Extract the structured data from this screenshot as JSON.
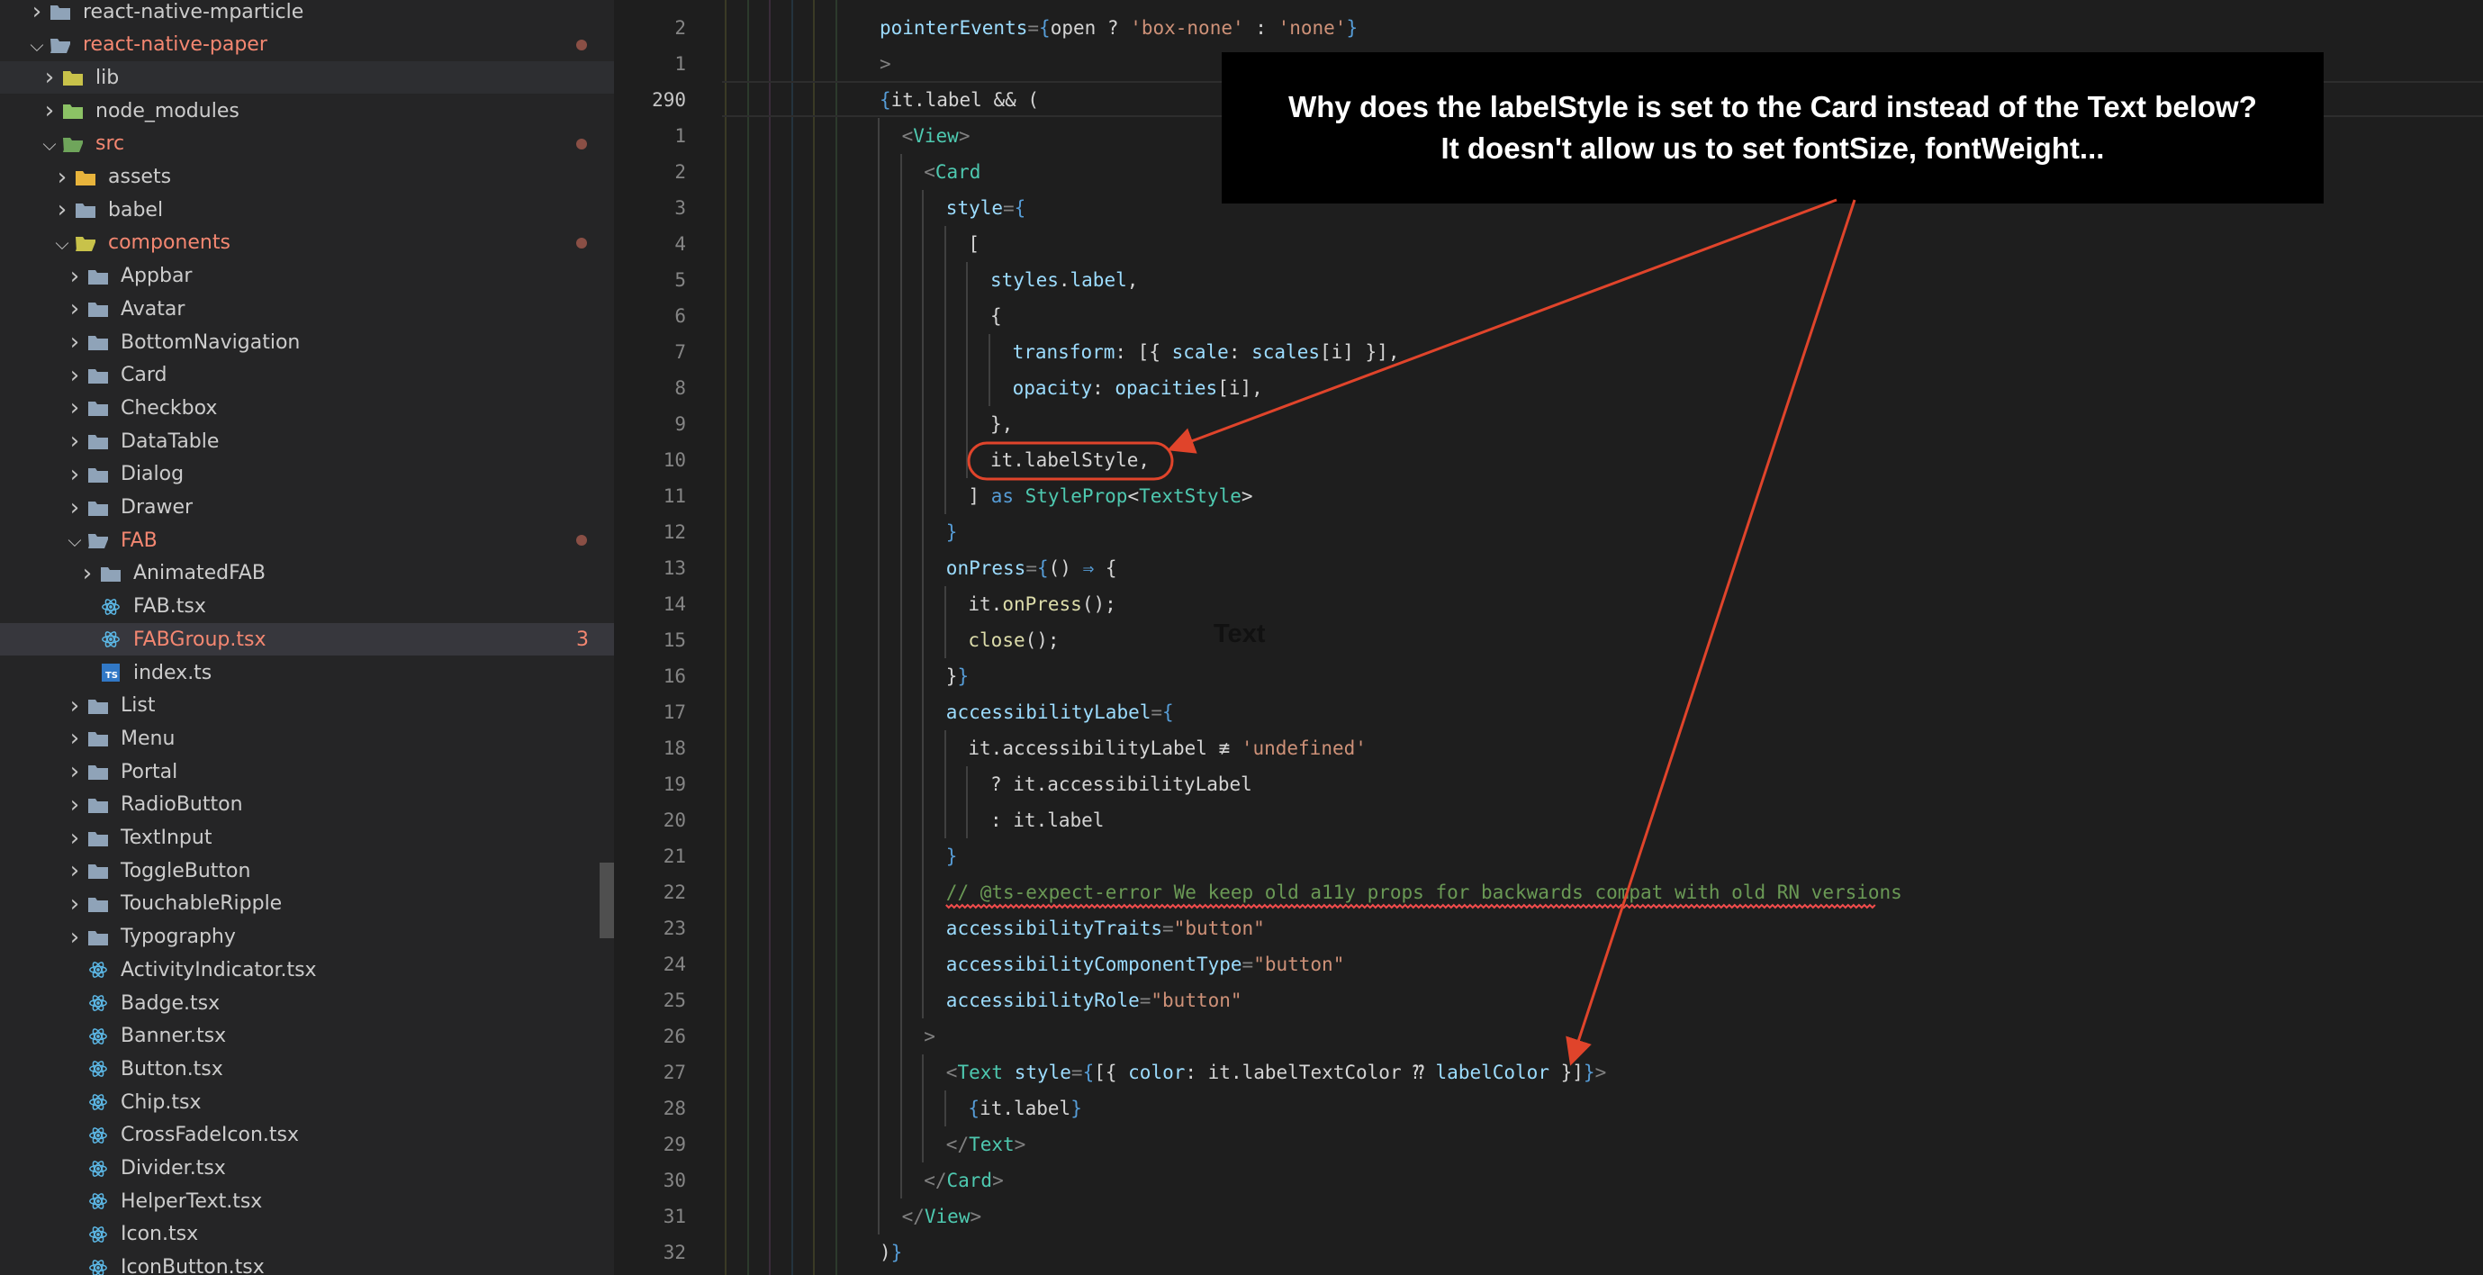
{
  "explorer": {
    "items": [
      {
        "label": "react-native-mparticle",
        "depth": 1,
        "kind": "folder",
        "open": false,
        "modified": false
      },
      {
        "label": "react-native-paper",
        "depth": 1,
        "kind": "folder",
        "open": true,
        "modified": true
      },
      {
        "label": "lib",
        "depth": 2,
        "kind": "folder-lib",
        "open": false,
        "modified": false
      },
      {
        "label": "node_modules",
        "depth": 2,
        "kind": "folder-node",
        "open": false,
        "modified": false
      },
      {
        "label": "src",
        "depth": 2,
        "kind": "folder-src",
        "open": true,
        "modified": true
      },
      {
        "label": "assets",
        "depth": 3,
        "kind": "folder-assets",
        "open": false,
        "modified": false
      },
      {
        "label": "babel",
        "depth": 3,
        "kind": "folder",
        "open": false,
        "modified": false
      },
      {
        "label": "components",
        "depth": 3,
        "kind": "folder-components",
        "open": true,
        "modified": true
      },
      {
        "label": "Appbar",
        "depth": 4,
        "kind": "folder",
        "open": false,
        "modified": false
      },
      {
        "label": "Avatar",
        "depth": 4,
        "kind": "folder",
        "open": false,
        "modified": false
      },
      {
        "label": "BottomNavigation",
        "depth": 4,
        "kind": "folder",
        "open": false,
        "modified": false
      },
      {
        "label": "Card",
        "depth": 4,
        "kind": "folder",
        "open": false,
        "modified": false
      },
      {
        "label": "Checkbox",
        "depth": 4,
        "kind": "folder",
        "open": false,
        "modified": false
      },
      {
        "label": "DataTable",
        "depth": 4,
        "kind": "folder",
        "open": false,
        "modified": false
      },
      {
        "label": "Dialog",
        "depth": 4,
        "kind": "folder",
        "open": false,
        "modified": false
      },
      {
        "label": "Drawer",
        "depth": 4,
        "kind": "folder",
        "open": false,
        "modified": false
      },
      {
        "label": "FAB",
        "depth": 4,
        "kind": "folder",
        "open": true,
        "modified": true
      },
      {
        "label": "AnimatedFAB",
        "depth": 5,
        "kind": "folder",
        "open": false,
        "modified": false
      },
      {
        "label": "FAB.tsx",
        "depth": 5,
        "kind": "react",
        "modified": false
      },
      {
        "label": "FABGroup.tsx",
        "depth": 5,
        "kind": "react",
        "modified": true,
        "badge": "3",
        "selected": true
      },
      {
        "label": "index.ts",
        "depth": 5,
        "kind": "ts",
        "modified": false
      },
      {
        "label": "List",
        "depth": 4,
        "kind": "folder",
        "open": false,
        "modified": false
      },
      {
        "label": "Menu",
        "depth": 4,
        "kind": "folder",
        "open": false,
        "modified": false
      },
      {
        "label": "Portal",
        "depth": 4,
        "kind": "folder",
        "open": false,
        "modified": false
      },
      {
        "label": "RadioButton",
        "depth": 4,
        "kind": "folder",
        "open": false,
        "modified": false
      },
      {
        "label": "TextInput",
        "depth": 4,
        "kind": "folder",
        "open": false,
        "modified": false
      },
      {
        "label": "ToggleButton",
        "depth": 4,
        "kind": "folder",
        "open": false,
        "modified": false
      },
      {
        "label": "TouchableRipple",
        "depth": 4,
        "kind": "folder",
        "open": false,
        "modified": false
      },
      {
        "label": "Typography",
        "depth": 4,
        "kind": "folder",
        "open": false,
        "modified": false
      },
      {
        "label": "ActivityIndicator.tsx",
        "depth": 4,
        "kind": "react",
        "modified": false
      },
      {
        "label": "Badge.tsx",
        "depth": 4,
        "kind": "react",
        "modified": false
      },
      {
        "label": "Banner.tsx",
        "depth": 4,
        "kind": "react",
        "modified": false
      },
      {
        "label": "Button.tsx",
        "depth": 4,
        "kind": "react",
        "modified": false
      },
      {
        "label": "Chip.tsx",
        "depth": 4,
        "kind": "react",
        "modified": false
      },
      {
        "label": "CrossFadeIcon.tsx",
        "depth": 4,
        "kind": "react",
        "modified": false
      },
      {
        "label": "Divider.tsx",
        "depth": 4,
        "kind": "react",
        "modified": false
      },
      {
        "label": "HelperText.tsx",
        "depth": 4,
        "kind": "react",
        "modified": false
      },
      {
        "label": "Icon.tsx",
        "depth": 4,
        "kind": "react",
        "modified": false
      },
      {
        "label": "IconButton.tsx",
        "depth": 4,
        "kind": "react",
        "modified": false
      }
    ]
  },
  "editor": {
    "lines": [
      {
        "num": "2",
        "indent": 0,
        "tokens": [
          [
            "attr",
            "pointerEvents"
          ],
          [
            "punc",
            "="
          ],
          [
            "br",
            "{"
          ],
          [
            "var",
            "open ? "
          ],
          [
            "str",
            "'box-none'"
          ],
          [
            "var",
            " : "
          ],
          [
            "str",
            "'none'"
          ],
          [
            "br",
            "}"
          ]
        ]
      },
      {
        "num": "1",
        "indent": 0,
        "tokens": [
          [
            "punc",
            ">"
          ]
        ]
      },
      {
        "num": "290",
        "indent": 0,
        "current": true,
        "tokens": [
          [
            "br",
            "{"
          ],
          [
            "var",
            "it.label && ("
          ]
        ]
      },
      {
        "num": "1",
        "indent": 1,
        "tokens": [
          [
            "punc",
            "<"
          ],
          [
            "tag",
            "View"
          ],
          [
            "punc",
            ">"
          ]
        ]
      },
      {
        "num": "2",
        "indent": 2,
        "tokens": [
          [
            "punc",
            "<"
          ],
          [
            "tag",
            "Card"
          ]
        ]
      },
      {
        "num": "3",
        "indent": 3,
        "tokens": [
          [
            "attr",
            "style"
          ],
          [
            "punc",
            "="
          ],
          [
            "br",
            "{"
          ]
        ]
      },
      {
        "num": "4",
        "indent": 4,
        "tokens": [
          [
            "var",
            "["
          ]
        ]
      },
      {
        "num": "5",
        "indent": 5,
        "tokens": [
          [
            "attr",
            "styles"
          ],
          [
            "var",
            "."
          ],
          [
            "attr",
            "label"
          ],
          [
            "var",
            ","
          ]
        ]
      },
      {
        "num": "6",
        "indent": 5,
        "tokens": [
          [
            "var",
            "{"
          ]
        ]
      },
      {
        "num": "7",
        "indent": 6,
        "tokens": [
          [
            "attr",
            "transform"
          ],
          [
            "var",
            ": [{ "
          ],
          [
            "attr",
            "scale"
          ],
          [
            "var",
            ": "
          ],
          [
            "attr",
            "scales"
          ],
          [
            "var",
            "[i] }],"
          ]
        ]
      },
      {
        "num": "8",
        "indent": 6,
        "tokens": [
          [
            "attr",
            "opacity"
          ],
          [
            "var",
            ": "
          ],
          [
            "attr",
            "opacities"
          ],
          [
            "var",
            "[i],"
          ]
        ]
      },
      {
        "num": "9",
        "indent": 5,
        "tokens": [
          [
            "var",
            "},"
          ]
        ]
      },
      {
        "num": "10",
        "indent": 5,
        "tokens": [
          [
            "var",
            "it.labelStyle,"
          ]
        ]
      },
      {
        "num": "11",
        "indent": 4,
        "tokens": [
          [
            "var",
            "] "
          ],
          [
            "kw",
            "as"
          ],
          [
            "var",
            " "
          ],
          [
            "type",
            "StyleProp"
          ],
          [
            "var",
            "<"
          ],
          [
            "type",
            "TextStyle"
          ],
          [
            "var",
            ">"
          ]
        ]
      },
      {
        "num": "12",
        "indent": 3,
        "tokens": [
          [
            "br",
            "}"
          ]
        ]
      },
      {
        "num": "13",
        "indent": 3,
        "tokens": [
          [
            "attr",
            "onPress"
          ],
          [
            "punc",
            "="
          ],
          [
            "br",
            "{"
          ],
          [
            "var",
            "() "
          ],
          [
            "kw",
            "⇒"
          ],
          [
            "var",
            " {"
          ]
        ]
      },
      {
        "num": "14",
        "indent": 4,
        "tokens": [
          [
            "var",
            "it."
          ],
          [
            "fn",
            "onPress"
          ],
          [
            "var",
            "();"
          ]
        ]
      },
      {
        "num": "15",
        "indent": 4,
        "tokens": [
          [
            "fn",
            "close"
          ],
          [
            "var",
            "();"
          ]
        ]
      },
      {
        "num": "16",
        "indent": 3,
        "tokens": [
          [
            "var",
            "}"
          ],
          [
            "br",
            "}"
          ]
        ]
      },
      {
        "num": "17",
        "indent": 3,
        "tokens": [
          [
            "attr",
            "accessibilityLabel"
          ],
          [
            "punc",
            "="
          ],
          [
            "br",
            "{"
          ]
        ]
      },
      {
        "num": "18",
        "indent": 4,
        "tokens": [
          [
            "var",
            "it.accessibilityLabel ≢ "
          ],
          [
            "str",
            "'undefined'"
          ]
        ]
      },
      {
        "num": "19",
        "indent": 5,
        "tokens": [
          [
            "var",
            "? it.accessibilityLabel"
          ]
        ]
      },
      {
        "num": "20",
        "indent": 5,
        "tokens": [
          [
            "var",
            ": it.label"
          ]
        ]
      },
      {
        "num": "21",
        "indent": 3,
        "tokens": [
          [
            "br",
            "}"
          ]
        ]
      },
      {
        "num": "22",
        "indent": 3,
        "error": true,
        "tokens": [
          [
            "com",
            "// @ts-expect-error We keep old a11y props for backwards compat with old RN versions"
          ]
        ]
      },
      {
        "num": "23",
        "indent": 3,
        "tokens": [
          [
            "attr",
            "accessibilityTraits"
          ],
          [
            "punc",
            "="
          ],
          [
            "str",
            "\"button\""
          ]
        ]
      },
      {
        "num": "24",
        "indent": 3,
        "tokens": [
          [
            "attr",
            "accessibilityComponentType"
          ],
          [
            "punc",
            "="
          ],
          [
            "str",
            "\"button\""
          ]
        ]
      },
      {
        "num": "25",
        "indent": 3,
        "tokens": [
          [
            "attr",
            "accessibilityRole"
          ],
          [
            "punc",
            "="
          ],
          [
            "str",
            "\"button\""
          ]
        ]
      },
      {
        "num": "26",
        "indent": 2,
        "tokens": [
          [
            "punc",
            ">"
          ]
        ]
      },
      {
        "num": "27",
        "indent": 3,
        "tokens": [
          [
            "punc",
            "<"
          ],
          [
            "tag",
            "Text"
          ],
          [
            "var",
            " "
          ],
          [
            "attr",
            "style"
          ],
          [
            "punc",
            "="
          ],
          [
            "br",
            "{"
          ],
          [
            "var",
            "[{ "
          ],
          [
            "attr",
            "color"
          ],
          [
            "var",
            ": it.labelTextColor ⁇ "
          ],
          [
            "attr",
            "labelColor"
          ],
          [
            "var",
            " }]"
          ],
          [
            "br",
            "}"
          ],
          [
            "punc",
            ">"
          ]
        ]
      },
      {
        "num": "28",
        "indent": 4,
        "tokens": [
          [
            "br",
            "{"
          ],
          [
            "var",
            "it.label"
          ],
          [
            "br",
            "}"
          ]
        ]
      },
      {
        "num": "29",
        "indent": 3,
        "tokens": [
          [
            "punc",
            "</"
          ],
          [
            "tag",
            "Text"
          ],
          [
            "punc",
            ">"
          ]
        ]
      },
      {
        "num": "30",
        "indent": 2,
        "tokens": [
          [
            "punc",
            "</"
          ],
          [
            "tag",
            "Card"
          ],
          [
            "punc",
            ">"
          ]
        ]
      },
      {
        "num": "31",
        "indent": 1,
        "tokens": [
          [
            "punc",
            "</"
          ],
          [
            "tag",
            "View"
          ],
          [
            "punc",
            ">"
          ]
        ]
      },
      {
        "num": "32",
        "indent": 0,
        "tokens": [
          [
            "var",
            ")"
          ],
          [
            "br",
            "}"
          ]
        ]
      }
    ]
  },
  "annotation": {
    "callout_line1": "Why does the labelStyle is set to the Card instead of the Text below?",
    "callout_line2": "It doesn't allow us to set fontSize, fontWeight...",
    "floating_label": "Text",
    "color": "#e0442b"
  }
}
